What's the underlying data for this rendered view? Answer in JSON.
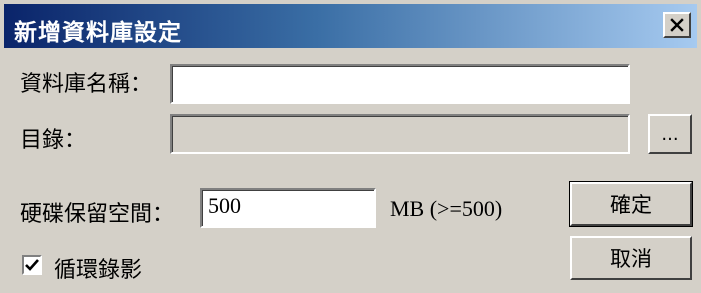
{
  "dialog": {
    "title": "新增資料庫設定",
    "close_label": "×"
  },
  "form": {
    "db_name_label": "資料庫名稱：",
    "db_name_value": "",
    "directory_label": "目錄：",
    "directory_value": "",
    "browse_label": "...",
    "disk_space_label": "硬碟保留空間：",
    "disk_space_value": "500",
    "disk_space_unit": "MB (>=500)",
    "loop_record_label": "循環錄影",
    "loop_record_checked": true
  },
  "buttons": {
    "ok_label": "確定",
    "cancel_label": "取消"
  }
}
